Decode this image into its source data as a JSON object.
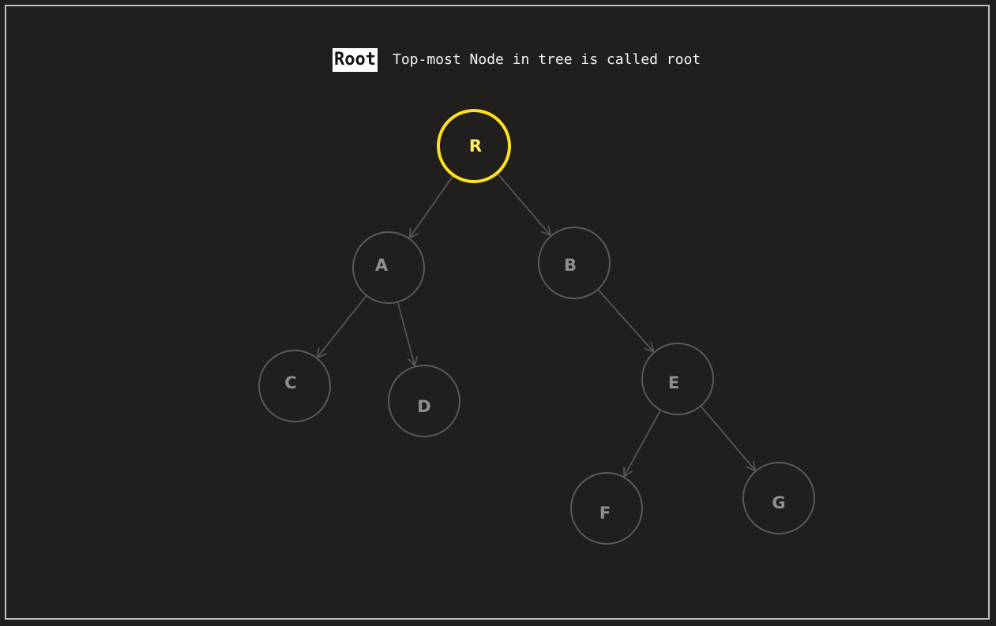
{
  "title": {
    "term": "Root",
    "definition": "Top-most Node in tree is called root"
  },
  "colors": {
    "background": "#201f1e",
    "border": "#bdbdbd",
    "highlight": "#ffe01a",
    "highlight_label": "#ffef5a",
    "dim_node": "#595959",
    "dim_label": "#8e8e8e",
    "edge": "#555555"
  },
  "diagram": {
    "highlighted_node": "R",
    "nodes": [
      {
        "id": "R",
        "label": "R"
      },
      {
        "id": "A",
        "label": "A"
      },
      {
        "id": "B",
        "label": "B"
      },
      {
        "id": "C",
        "label": "C"
      },
      {
        "id": "D",
        "label": "D"
      },
      {
        "id": "E",
        "label": "E"
      },
      {
        "id": "F",
        "label": "F"
      },
      {
        "id": "G",
        "label": "G"
      }
    ],
    "edges": [
      {
        "from": "R",
        "to": "A"
      },
      {
        "from": "R",
        "to": "B"
      },
      {
        "from": "A",
        "to": "C"
      },
      {
        "from": "A",
        "to": "D"
      },
      {
        "from": "B",
        "to": "E"
      },
      {
        "from": "E",
        "to": "F"
      },
      {
        "from": "E",
        "to": "G"
      }
    ]
  }
}
